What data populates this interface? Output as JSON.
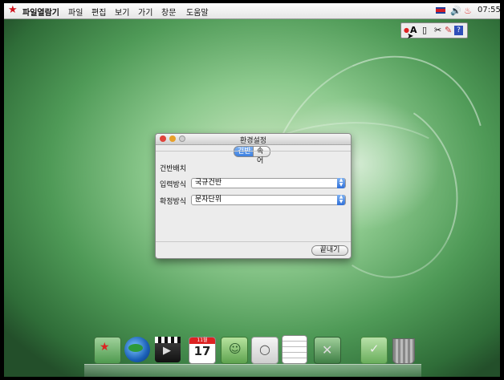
{
  "menubar": {
    "app_name": "파일열람기",
    "items": [
      "파일",
      "편집",
      "보기",
      "가기",
      "창문",
      "도움말"
    ],
    "clock": "07:55"
  },
  "ime_toolbar": {
    "mode_label": "A",
    "help_label": "?"
  },
  "dialog": {
    "title": "환경설정",
    "tabs": [
      {
        "label": "건반",
        "active": true
      },
      {
        "label": "속어",
        "active": false
      }
    ],
    "section_title": "건반배치",
    "rows": [
      {
        "label": "입력방식",
        "value": "국규건반"
      },
      {
        "label": "확정방식",
        "value": "문자단위"
      }
    ],
    "close_button": "끝내기"
  },
  "dock": {
    "calendar_month": "11월",
    "calendar_day": "17"
  },
  "colors": {
    "accent": "#3c7fe0",
    "star": "#d0101a",
    "desktop_green": "#8cc98d"
  }
}
